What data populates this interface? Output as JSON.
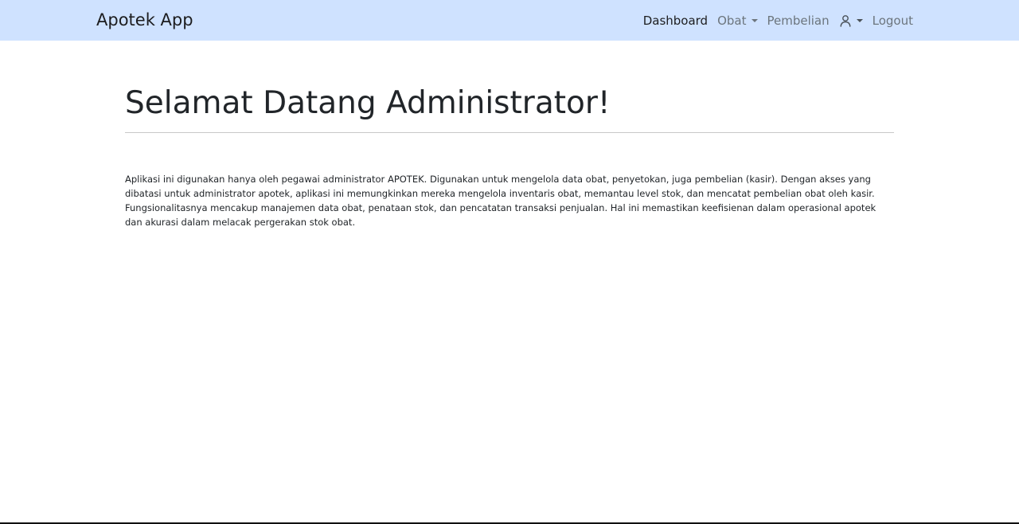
{
  "navbar": {
    "brand": "Apotek App",
    "items": {
      "dashboard": "Dashboard",
      "obat": "Obat",
      "pembelian": "Pembelian",
      "logout": "Logout"
    },
    "icons": {
      "user": "user-icon",
      "caret": "caret-down-icon"
    },
    "background": "#cfe2ff"
  },
  "main": {
    "title": "Selamat Datang Administrator!",
    "description": "Aplikasi ini digunakan hanya oleh pegawai administrator APOTEK. Digunakan untuk mengelola data obat, penyetokan, juga pembelian (kasir). Dengan akses yang dibatasi untuk administrator apotek, aplikasi ini memungkinkan mereka mengelola inventaris obat, memantau level stok, dan mencatat pembelian obat oleh kasir. Fungsionalitasnya mencakup manajemen data obat, penataan stok, dan pencatatan transaksi penjualan. Hal ini memastikan keefisienan dalam operasional apotek dan akurasi dalam melacak pergerakan stok obat."
  }
}
